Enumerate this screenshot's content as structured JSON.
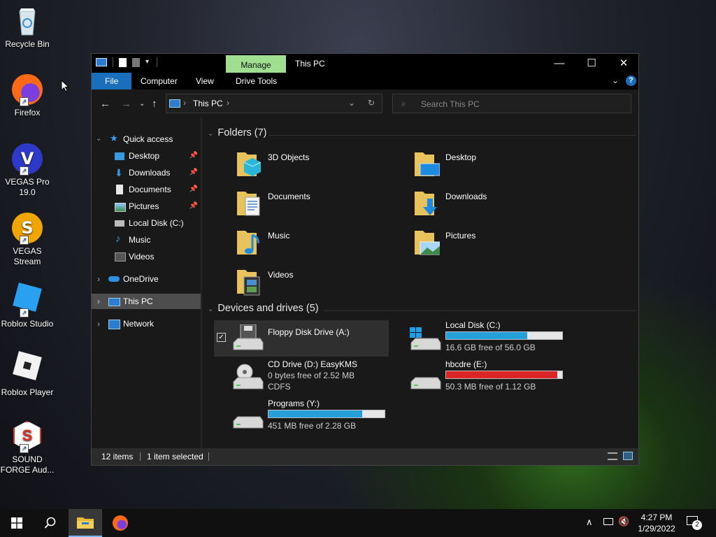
{
  "desktop": {
    "icons": [
      {
        "label": "Recycle Bin"
      },
      {
        "label": "Firefox"
      },
      {
        "label": "VEGAS Pro 19.0"
      },
      {
        "label": "VEGAS Stream"
      },
      {
        "label": "Roblox Studio"
      },
      {
        "label": "Roblox Player"
      },
      {
        "label": "SOUND FORGE Aud..."
      }
    ]
  },
  "window": {
    "title": "This PC",
    "manage_tab": "Manage",
    "ribbon_tabs": [
      "File",
      "Computer",
      "View",
      "Drive Tools"
    ],
    "address": {
      "location": "This PC"
    },
    "search": {
      "placeholder": "Search This PC"
    },
    "nav": {
      "quick_access": "Quick access",
      "quick_items": [
        "Desktop",
        "Downloads",
        "Documents",
        "Pictures",
        "Local Disk (C:)",
        "Music",
        "Videos"
      ],
      "onedrive": "OneDrive",
      "this_pc": "This PC",
      "network": "Network"
    },
    "folders_header": "Folders (7)",
    "folders": [
      "3D Objects",
      "Desktop",
      "Documents",
      "Downloads",
      "Music",
      "Pictures",
      "Videos"
    ],
    "devices_header": "Devices and drives (5)",
    "drives": [
      {
        "name": "Floppy Disk Drive (A:)",
        "line1": "",
        "line2": ""
      },
      {
        "name": "Local Disk (C:)",
        "line1": "16.6 GB free of 56.0 GB",
        "used_fraction": 0.7,
        "bar_color": "#26a0da"
      },
      {
        "name": "CD Drive (D:) EasyKMS",
        "line1": "0 bytes free of 2.52 MB",
        "line2": "CDFS"
      },
      {
        "name": "hbcdre (E:)",
        "line1": "50.3 MB free of 1.12 GB",
        "used_fraction": 0.96,
        "bar_color": "#da2626"
      },
      {
        "name": "Programs (Y:)",
        "line1": "451 MB free of 2.28 GB",
        "used_fraction": 0.81,
        "bar_color": "#26a0da"
      }
    ],
    "status": {
      "items": "12 items",
      "selected": "1 item selected"
    }
  },
  "taskbar": {
    "time": "4:27 PM",
    "date": "1/29/2022",
    "notification_count": "2"
  }
}
